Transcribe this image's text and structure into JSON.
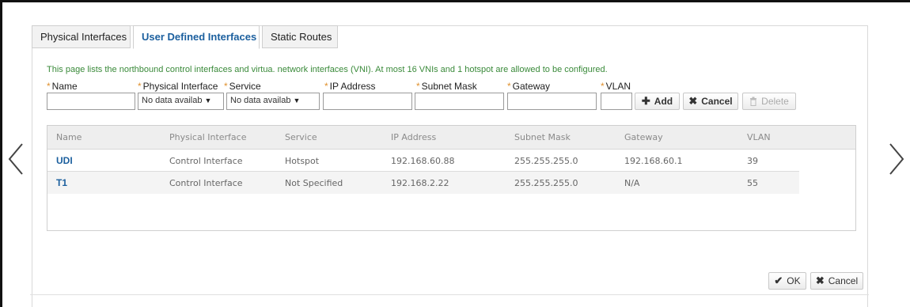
{
  "tabs": [
    {
      "label": "Physical Interfaces",
      "active": false
    },
    {
      "label": "User Defined Interfaces",
      "active": true
    },
    {
      "label": "Static Routes",
      "active": false
    }
  ],
  "info_text": "This page lists the northbound control interfaces and virtua. network interfaces (VNI). At most 16 VNIs and 1 hotspot are allowed to be configured.",
  "form": {
    "required_mark": "*",
    "labels": {
      "name": "Name",
      "physical_interface": "Physical Interface",
      "service": "Service",
      "ip_address": "IP Address",
      "subnet_mask": "Subnet Mask",
      "gateway": "Gateway",
      "vlan": "VLAN"
    },
    "physical_interface_value": "No data availab",
    "service_value": "No data availab",
    "caret": "▼",
    "buttons": {
      "add": "Add",
      "cancel": "Cancel",
      "delete": "Delete"
    }
  },
  "table": {
    "columns": [
      "Name",
      "Physical Interface",
      "Service",
      "IP Address",
      "Subnet Mask",
      "Gateway",
      "VLAN"
    ],
    "rows": [
      [
        "UDI",
        "Control Interface",
        "Hotspot",
        "192.168.60.88",
        "255.255.255.0",
        "192.168.60.1",
        "39"
      ],
      [
        "T1",
        "Control Interface",
        "Not Specified",
        "192.168.2.22",
        "255.255.255.0",
        "N/A",
        "55"
      ]
    ]
  },
  "footer": {
    "ok": "OK",
    "cancel": "Cancel"
  },
  "colors": {
    "tab_active": "#1b5f9e",
    "info_text": "#3a8a3a",
    "required": "#e0922f"
  },
  "icons": {
    "prev": "chevron-left-icon",
    "next": "chevron-right-icon",
    "add": "plus-icon",
    "cancel": "x-icon",
    "delete": "trash-icon",
    "ok": "checkmark-icon"
  }
}
